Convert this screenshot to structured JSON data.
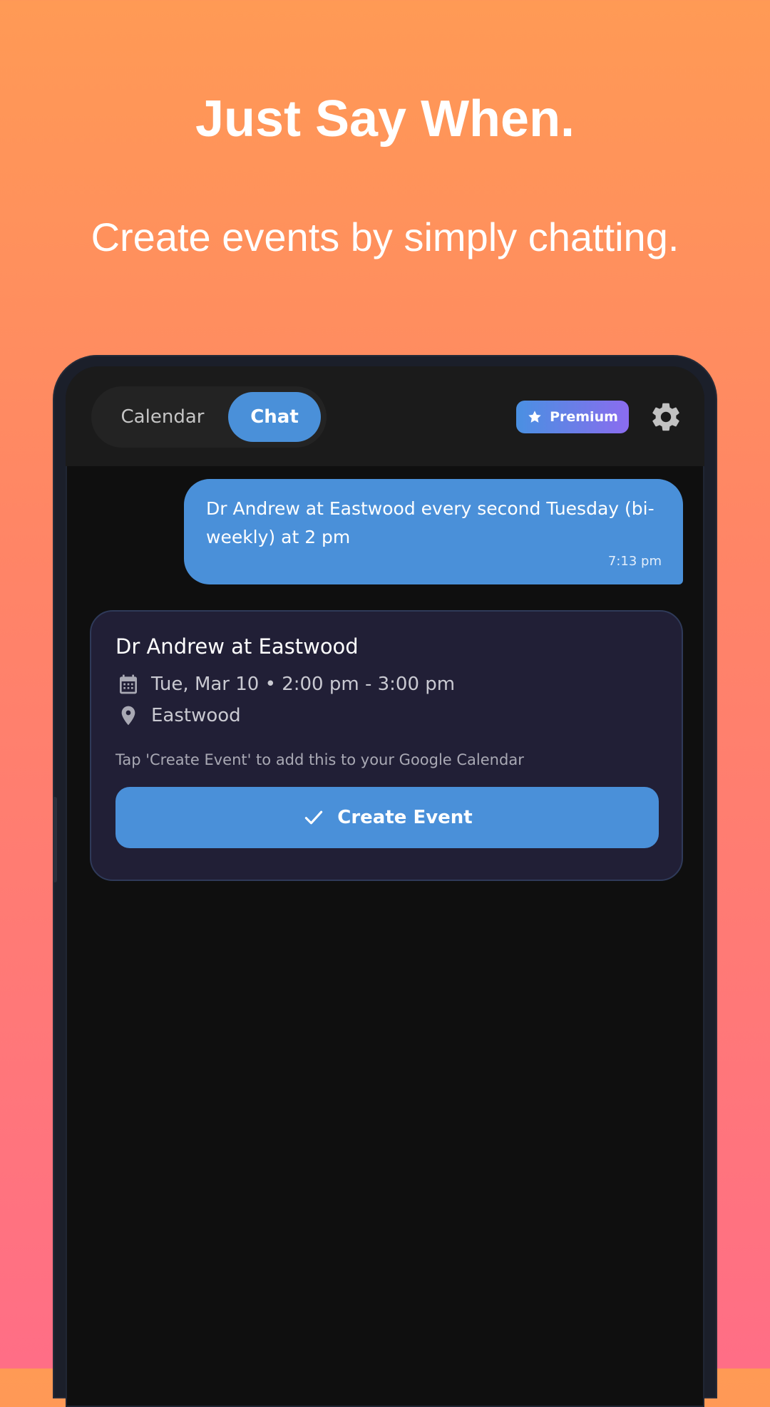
{
  "promo": {
    "headline": "Just Say When.",
    "subheadline": "Create events by simply chatting."
  },
  "app_bar": {
    "tabs": [
      {
        "label": "Calendar",
        "selected": false
      },
      {
        "label": "Chat",
        "selected": true
      }
    ],
    "premium_label": "Premium",
    "settings_icon": "gear-icon"
  },
  "chat": {
    "message_text": "Dr Andrew at Eastwood every second Tuesday (bi-weekly) at 2 pm",
    "message_time": "7:13 pm"
  },
  "event_card": {
    "title": "Dr Andrew at Eastwood",
    "date_time": "Tue, Mar 10 • 2:00 pm - 3:00 pm",
    "location": "Eastwood",
    "hint": "Tap 'Create Event' to add this to your Google Calendar",
    "create_label": "Create Event"
  },
  "colors": {
    "accent": "#4a90d9",
    "card_bg": "#211f36",
    "screen_bg": "#0f0f0f",
    "app_bar_bg": "#1b1b1b"
  }
}
